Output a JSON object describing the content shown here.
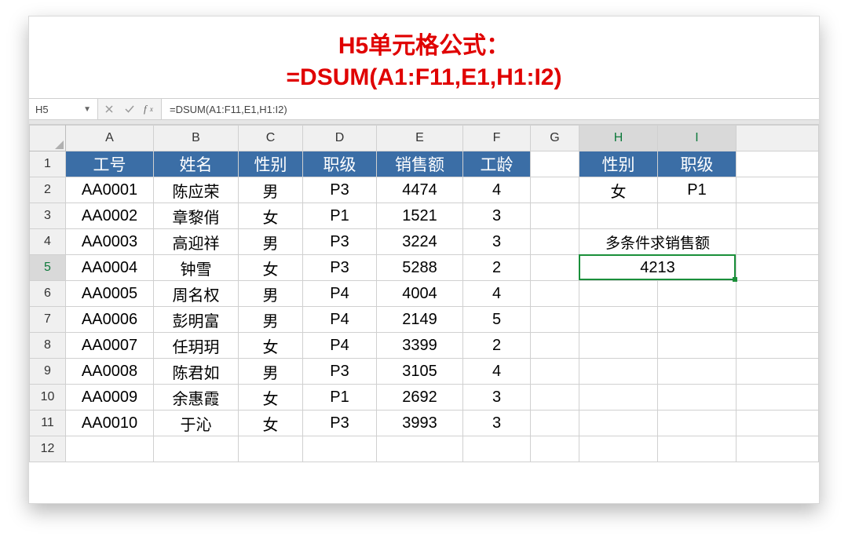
{
  "title": {
    "line1": "H5单元格公式：",
    "line2": "=DSUM(A1:F11,E1,H1:I2)"
  },
  "formula_bar": {
    "cell_ref": "H5",
    "formula": "=DSUM(A1:F11,E1,H1:I2)"
  },
  "columns": [
    "A",
    "B",
    "C",
    "D",
    "E",
    "F",
    "G",
    "H",
    "I"
  ],
  "row_numbers": [
    1,
    2,
    3,
    4,
    5,
    6,
    7,
    8,
    9,
    10,
    11,
    12
  ],
  "headers_main": {
    "A": "工号",
    "B": "姓名",
    "C": "性别",
    "D": "职级",
    "E": "销售额",
    "F": "工龄"
  },
  "headers_criteria": {
    "H": "性别",
    "I": "职级"
  },
  "criteria_row": {
    "H": "女",
    "I": "P1"
  },
  "result_label": "多条件求销售额",
  "result_value": "4213",
  "rows": [
    {
      "A": "AA0001",
      "B": "陈应荣",
      "C": "男",
      "D": "P3",
      "E": "4474",
      "F": "4"
    },
    {
      "A": "AA0002",
      "B": "章黎俏",
      "C": "女",
      "D": "P1",
      "E": "1521",
      "F": "3"
    },
    {
      "A": "AA0003",
      "B": "高迎祥",
      "C": "男",
      "D": "P3",
      "E": "3224",
      "F": "3"
    },
    {
      "A": "AA0004",
      "B": "钟雪",
      "C": "女",
      "D": "P3",
      "E": "5288",
      "F": "2"
    },
    {
      "A": "AA0005",
      "B": "周名权",
      "C": "男",
      "D": "P4",
      "E": "4004",
      "F": "4"
    },
    {
      "A": "AA0006",
      "B": "彭明富",
      "C": "男",
      "D": "P4",
      "E": "2149",
      "F": "5"
    },
    {
      "A": "AA0007",
      "B": "任玥玥",
      "C": "女",
      "D": "P4",
      "E": "3399",
      "F": "2"
    },
    {
      "A": "AA0008",
      "B": "陈君如",
      "C": "男",
      "D": "P3",
      "E": "3105",
      "F": "4"
    },
    {
      "A": "AA0009",
      "B": "余惠霞",
      "C": "女",
      "D": "P1",
      "E": "2692",
      "F": "3"
    },
    {
      "A": "AA0010",
      "B": "于沁",
      "C": "女",
      "D": "P3",
      "E": "3993",
      "F": "3"
    }
  ],
  "colors": {
    "header_bg": "#3b6ea6",
    "title_red": "#e00000",
    "sel_green": "#1a8f3a"
  }
}
